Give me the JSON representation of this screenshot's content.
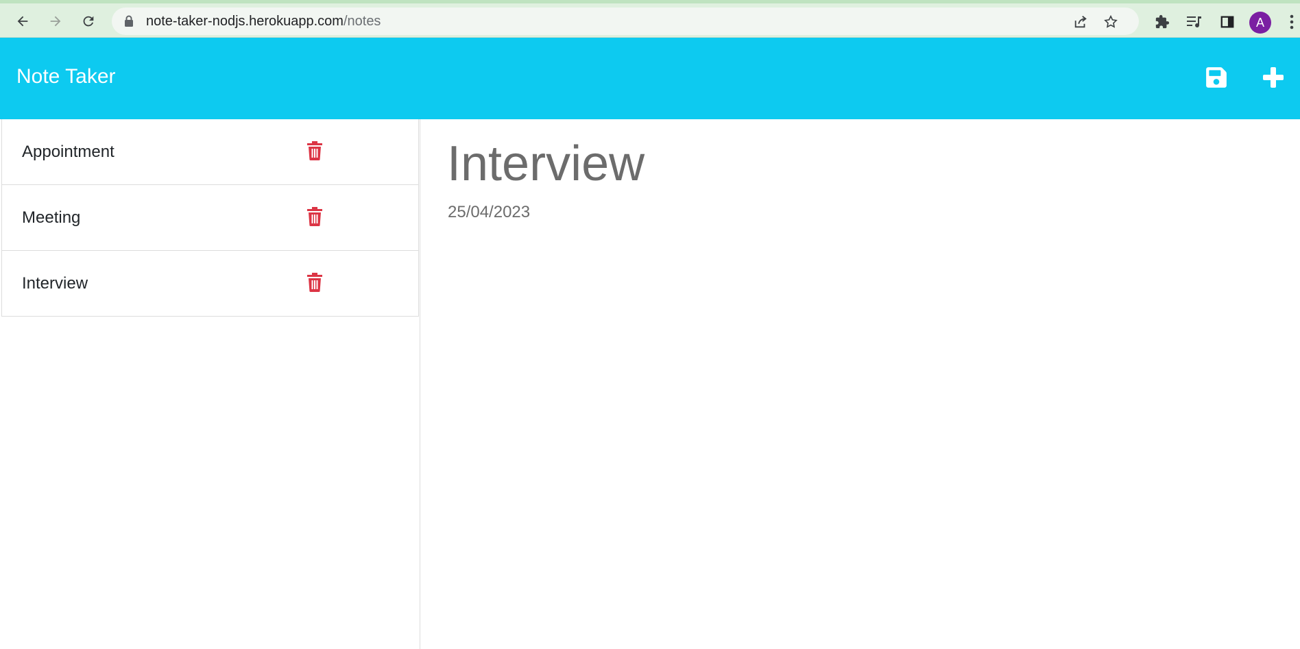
{
  "browser": {
    "url_host": "note-taker-nodjs.herokuapp.com",
    "url_path": "/notes",
    "avatar_letter": "A",
    "icons": [
      "back-icon",
      "forward-icon",
      "reload-icon",
      "lock-icon",
      "share-icon",
      "bookmark-star-icon",
      "extensions-icon",
      "media-control-icon",
      "side-panel-icon",
      "menu-kebab-icon"
    ]
  },
  "app": {
    "title": "Note Taker",
    "header_color": "#0dcaf0",
    "save_icon": "save-icon",
    "new_icon": "plus-icon"
  },
  "notes": [
    {
      "title": "Appointment"
    },
    {
      "title": "Meeting"
    },
    {
      "title": "Interview"
    }
  ],
  "active_note": {
    "title": "Interview",
    "text": "25/04/2023"
  },
  "colors": {
    "delete": "#dc3545",
    "note_text": "#6c6c6c"
  }
}
